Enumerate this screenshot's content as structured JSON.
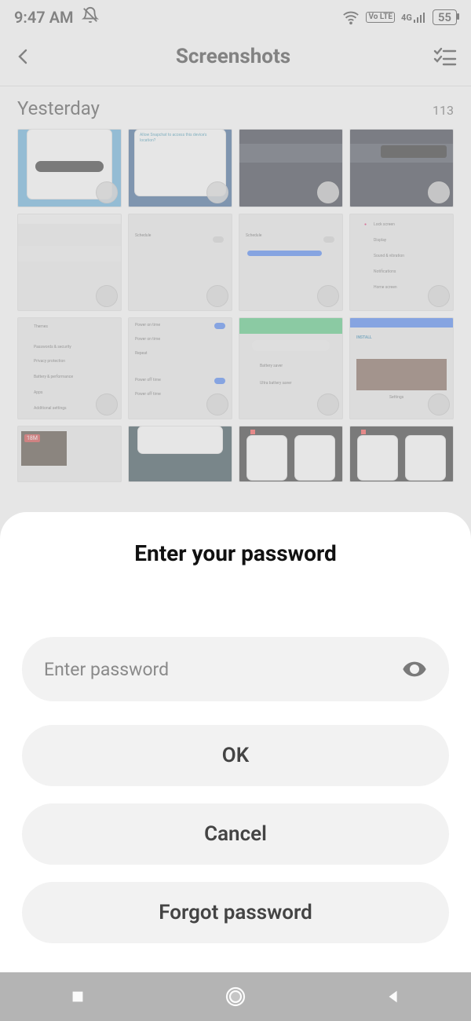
{
  "status": {
    "time": "9:47 AM",
    "dnd_icon": "bell-off-icon",
    "wifi_icon": "wifi-icon",
    "volte_label": "Vo LTE",
    "signal_label": "4G",
    "battery_pct": "55"
  },
  "header": {
    "title": "Screenshots",
    "back_icon": "chevron-left-icon",
    "select_icon": "multiselect-icon"
  },
  "section": {
    "label": "Yesterday",
    "count": "113"
  },
  "dialog": {
    "title": "Enter your password",
    "placeholder": "Enter password",
    "toggle_icon": "eye-icon",
    "ok_label": "OK",
    "cancel_label": "Cancel",
    "forgot_label": "Forgot password"
  },
  "navbar": {
    "recent_icon": "square-icon",
    "home_icon": "circle-icon",
    "back_icon": "triangle-left-icon"
  },
  "thumbs": {
    "generic_label": "screenshot-thumbnail"
  }
}
